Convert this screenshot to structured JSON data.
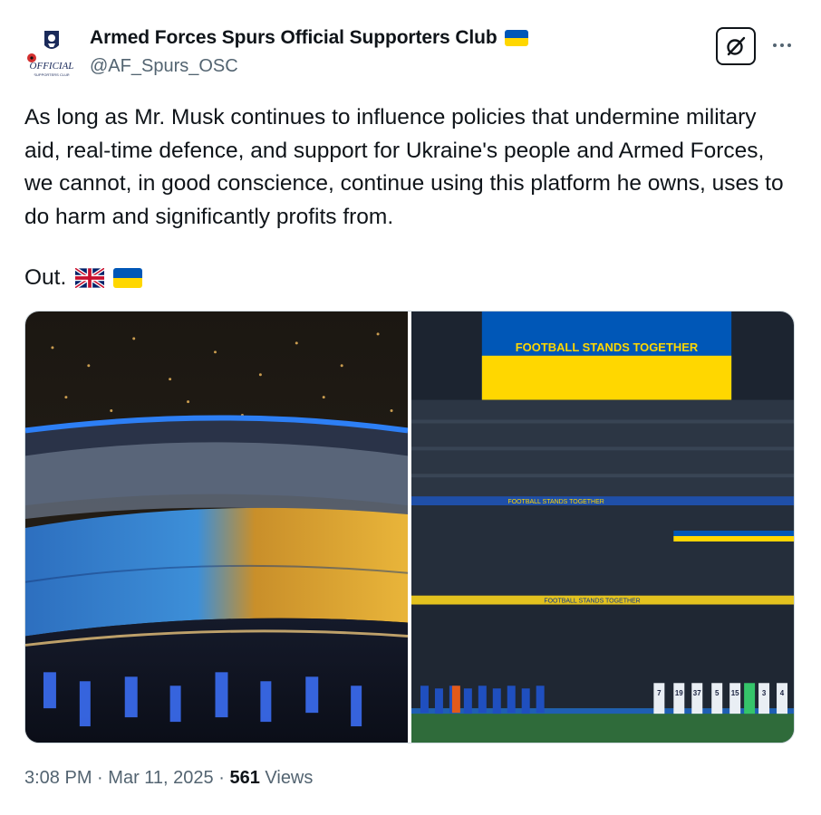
{
  "author": {
    "display_name": "Armed Forces Spurs Official Supporters Club",
    "handle": "@AF_Spurs_OSC",
    "avatar_text": "OFFICIAL",
    "avatar_subtext": "SUPPORTERS CLUB"
  },
  "colors": {
    "ukraine_blue": "#0057b7",
    "ukraine_yellow": "#ffd700",
    "text": "#0f1419",
    "muted": "#536471"
  },
  "icons": {
    "grok": "grok-icon",
    "more": "more-icon"
  },
  "tweet": {
    "text": "As long as Mr. Musk continues to influence policies that undermine military aid, real-time defence, and support for Ukraine's people and Armed Forces, we cannot, in good conscience, continue using this platform he owns, uses to do harm and significantly profits from.",
    "closing": "Out."
  },
  "media": {
    "right_screen_text": "FOOTBALL STANDS TOGETHER",
    "banner_text": "FOOTBALL STANDS TOGETHER",
    "shirt_numbers": [
      "7",
      "19",
      "37",
      "5",
      "15",
      "3",
      "4"
    ]
  },
  "meta": {
    "time": "3:08 PM",
    "separator": "·",
    "date": "Mar 11, 2025",
    "views_count": "561",
    "views_label": "Views"
  }
}
